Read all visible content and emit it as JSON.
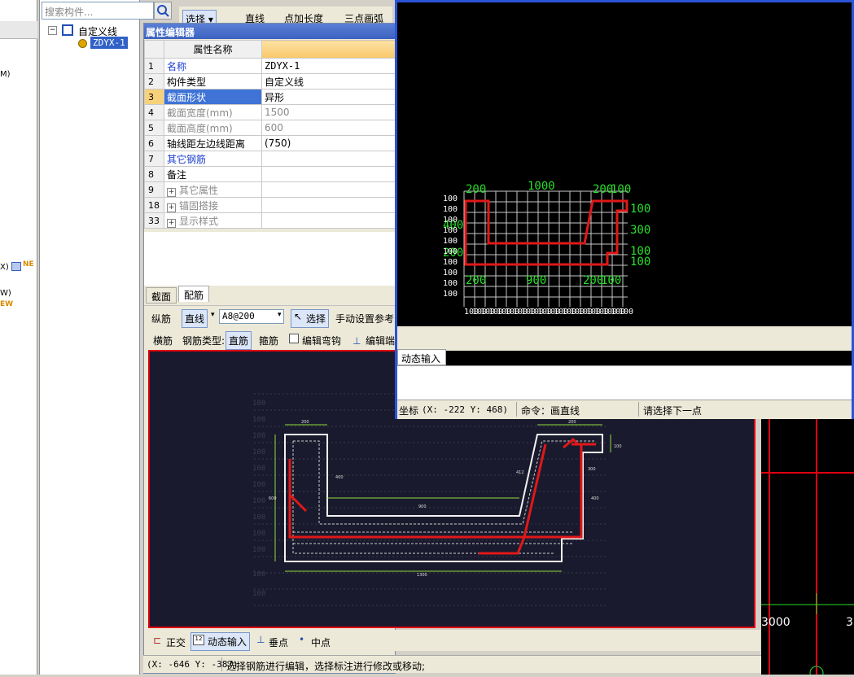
{
  "left_strip": {
    "texts": [
      "M)",
      "X)",
      "NE",
      "W)",
      "EW"
    ]
  },
  "tree": {
    "search_placeholder": "搜索构件...",
    "root_label": "自定义线",
    "child_label": "ZDYX-1"
  },
  "top_toolbar": {
    "select_label": "选择",
    "line_label": "直线",
    "point_len_label": "点加长度",
    "three_arc_label": "三点画弧"
  },
  "prop_editor": {
    "title": "属性编辑器",
    "col_header": "属性名称",
    "rows": [
      {
        "num": "1",
        "name": "名称",
        "value": "ZDYX-1"
      },
      {
        "num": "2",
        "name": "构件类型",
        "value": "自定义线"
      },
      {
        "num": "3",
        "name": "截面形状",
        "value": "异形"
      },
      {
        "num": "4",
        "name": "截面宽度(mm)",
        "value": "1500"
      },
      {
        "num": "5",
        "name": "截面高度(mm)",
        "value": "600"
      },
      {
        "num": "6",
        "name": "轴线距左边线距离",
        "value": "(750)"
      },
      {
        "num": "7",
        "name": "其它钢筋",
        "value": ""
      },
      {
        "num": "8",
        "name": "备注",
        "value": ""
      },
      {
        "num": "9",
        "name": "其它属性",
        "value": ""
      },
      {
        "num": "18",
        "name": "锚固搭接",
        "value": ""
      },
      {
        "num": "33",
        "name": "显示样式",
        "value": ""
      }
    ]
  },
  "tabs": {
    "section": "截面",
    "rebar": "配筋"
  },
  "rebar_toolbar": {
    "long_label": "纵筋",
    "line_mode": "直线",
    "spec_value": "A8@200",
    "select_label": "选择",
    "manual_ref": "手动设置参考",
    "trans_label": "横筋",
    "rebar_type_label": "钢筋类型:",
    "straight_label": "直筋",
    "stirrup_label": "箍筋",
    "edit_hook_label": "编辑弯钩",
    "edit_end_label": "编辑端"
  },
  "bottom_toolbar": {
    "ortho_label": "正交",
    "dynamic_label": "动态输入",
    "perp_label": "垂点",
    "mid_label": "中点"
  },
  "status": {
    "coords": "(X: -646 Y: -387)",
    "message": "选择钢筋进行编辑，选择标注进行修改或移动;"
  },
  "drawing": {
    "top_dims": [
      "200",
      "1000",
      "200",
      "100"
    ],
    "bottom_dims": [
      "200",
      "900",
      "200",
      "100"
    ],
    "right_dims": [
      "100",
      "300",
      "100",
      "100"
    ],
    "left_ticks": [
      "100",
      "100",
      "100",
      "100",
      "100",
      "100",
      "100",
      "100",
      "100",
      "100"
    ],
    "left_labels": [
      "400",
      "200"
    ],
    "bottom_ticks": [
      "100",
      "100",
      "100",
      "100",
      "100",
      "100",
      "100",
      "100",
      "100",
      "100",
      "100",
      "100",
      "100",
      "100",
      "100",
      "100",
      "100",
      "100",
      "100",
      "100"
    ],
    "dynamic_input_tab": "动态输入",
    "coords_label": "坐标",
    "coords_value": "(X: -222 Y: 468)",
    "command_label": "命令：画直线",
    "prompt": "请选择下一点"
  },
  "right_cad": {
    "label_left": "3000",
    "label_right": "3"
  },
  "colors": {
    "rebar_red": "#e01818",
    "dim_green": "#2adf2a",
    "frame_blue": "#2a55d8"
  }
}
